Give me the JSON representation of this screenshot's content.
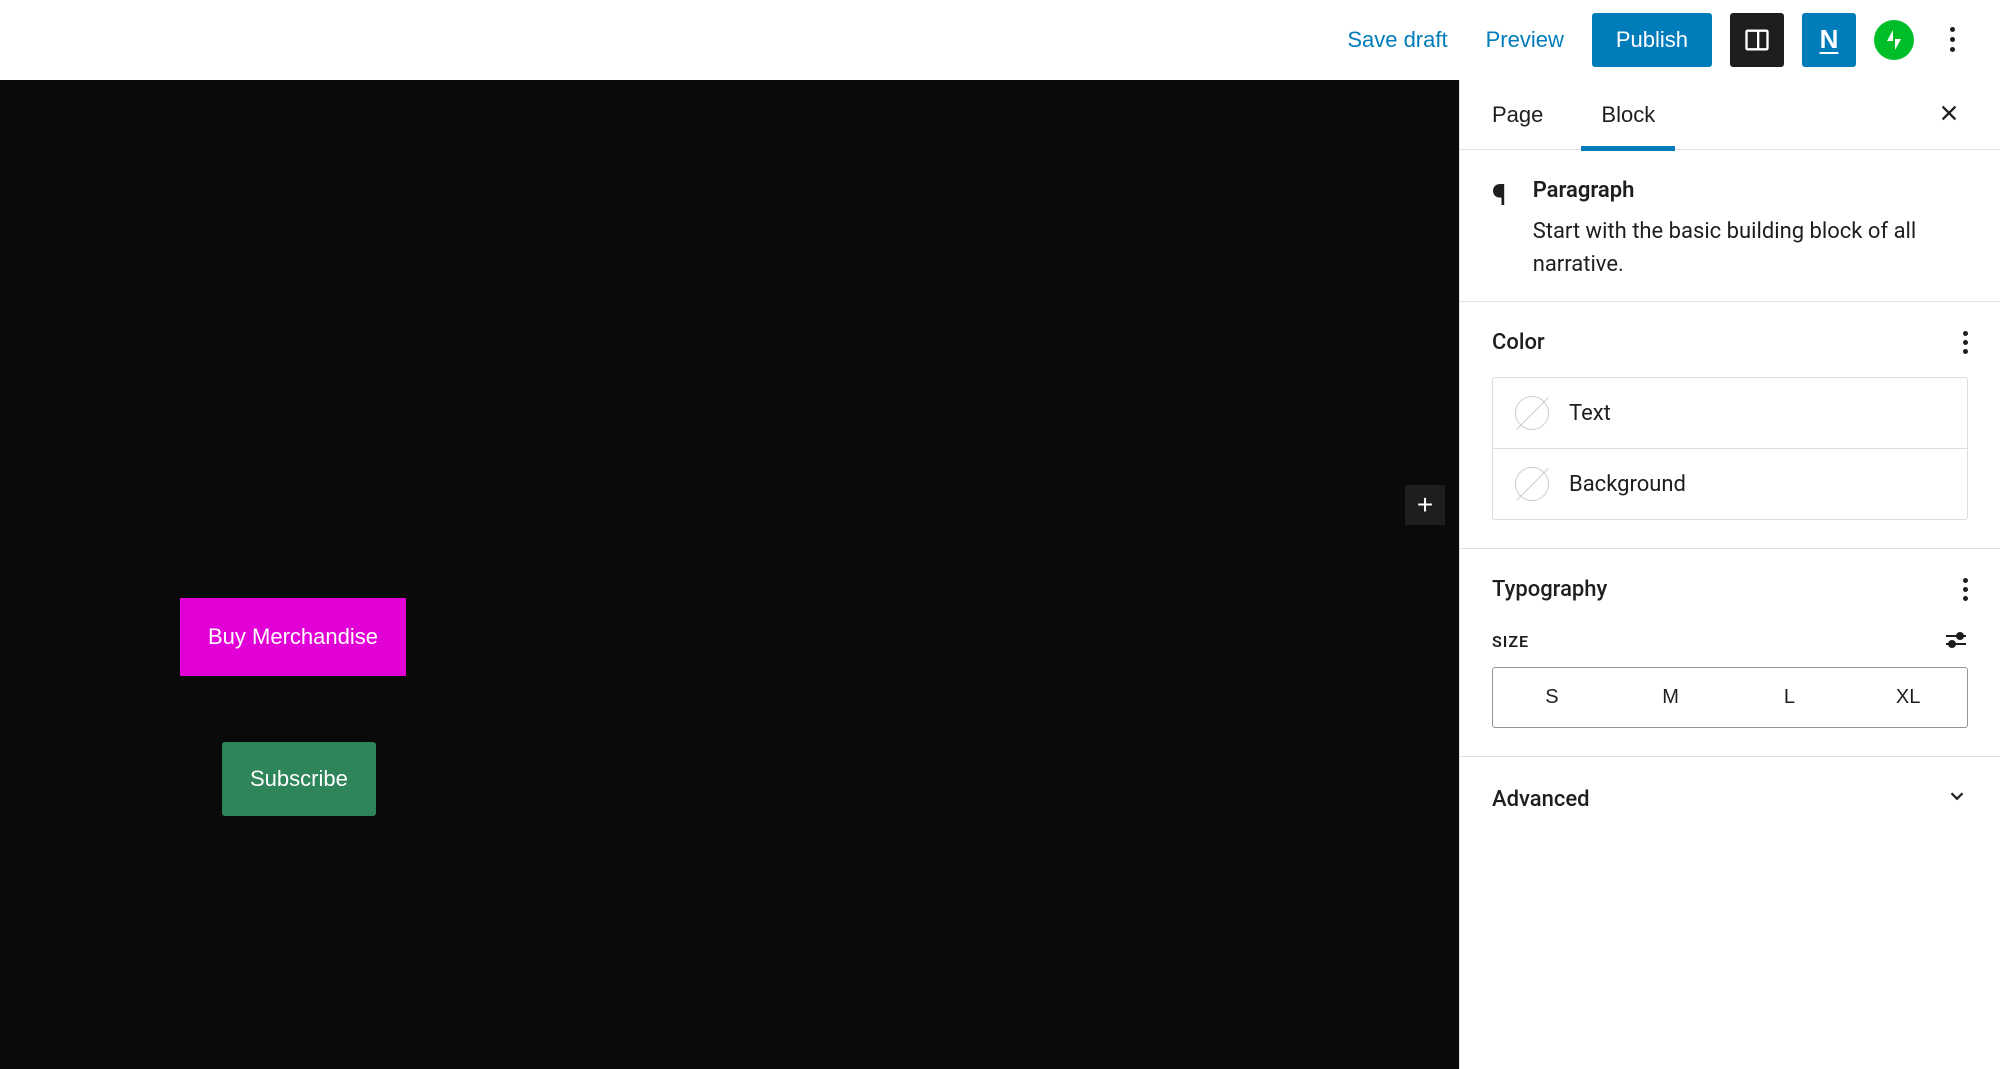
{
  "toolbar": {
    "save_draft": "Save draft",
    "preview": "Preview",
    "publish": "Publish",
    "n_label": "N"
  },
  "canvas": {
    "buy_merch": "Buy Merchandise",
    "subscribe": "Subscribe"
  },
  "sidebar": {
    "tabs": {
      "page": "Page",
      "block": "Block"
    },
    "block": {
      "title": "Paragraph",
      "desc": "Start with the basic building block of all narrative."
    },
    "color": {
      "heading": "Color",
      "text": "Text",
      "background": "Background"
    },
    "typography": {
      "heading": "Typography",
      "size_label": "SIZE",
      "sizes": [
        "S",
        "M",
        "L",
        "XL"
      ]
    },
    "advanced": "Advanced"
  }
}
